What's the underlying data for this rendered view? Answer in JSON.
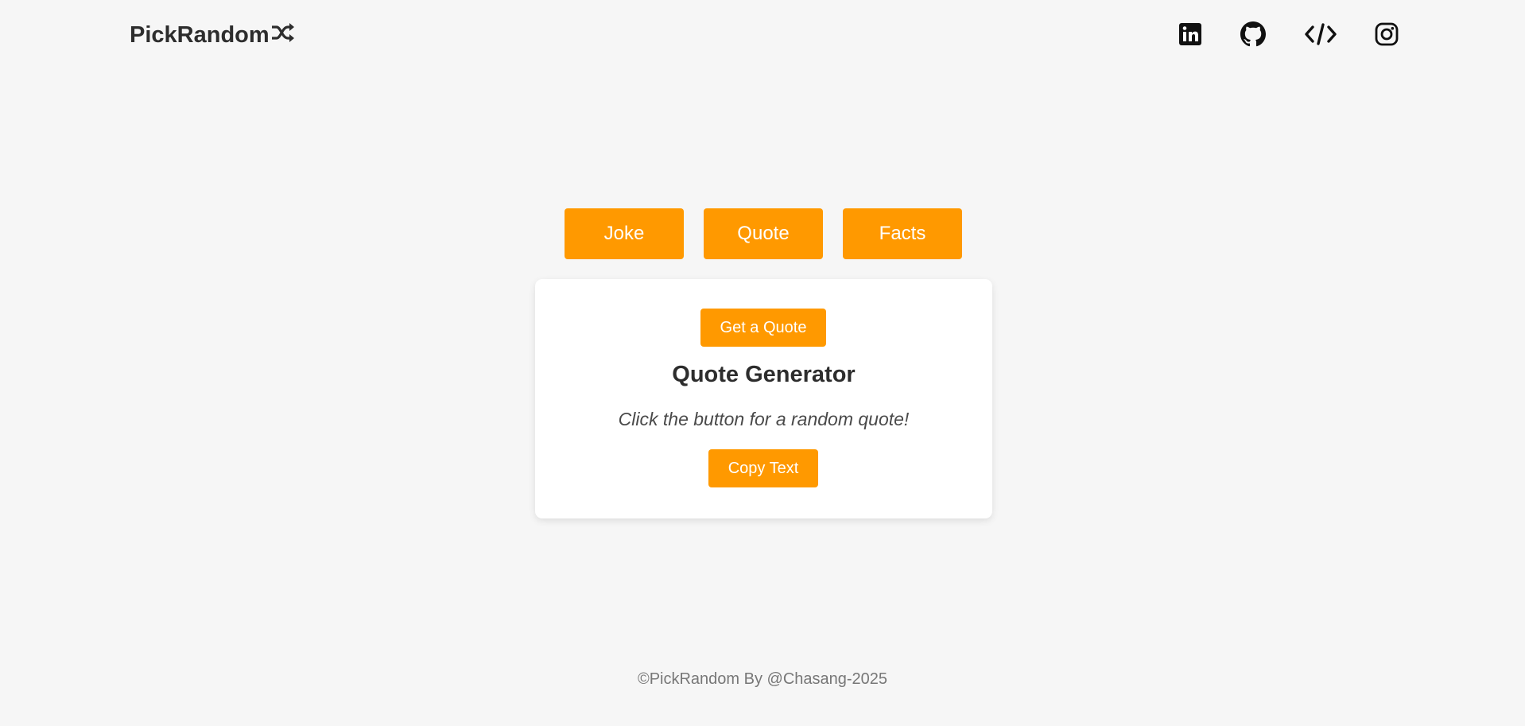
{
  "header": {
    "logo_text": "PickRandom",
    "logo_icon": "shuffle-icon",
    "social": [
      {
        "name": "linkedin-icon"
      },
      {
        "name": "github-icon"
      },
      {
        "name": "code-icon"
      },
      {
        "name": "instagram-icon"
      }
    ]
  },
  "tabs": [
    {
      "label": "Joke"
    },
    {
      "label": "Quote"
    },
    {
      "label": "Facts"
    }
  ],
  "card": {
    "get_button_label": "Get a Quote",
    "title": "Quote Generator",
    "text": "Click the button for a random quote!",
    "copy_button_label": "Copy Text"
  },
  "footer": {
    "text": "©PickRandom By @Chasang-2025"
  },
  "colors": {
    "accent": "#ff9900",
    "background": "#f6f6f6",
    "card": "#ffffff",
    "text": "#2d2d2d"
  }
}
